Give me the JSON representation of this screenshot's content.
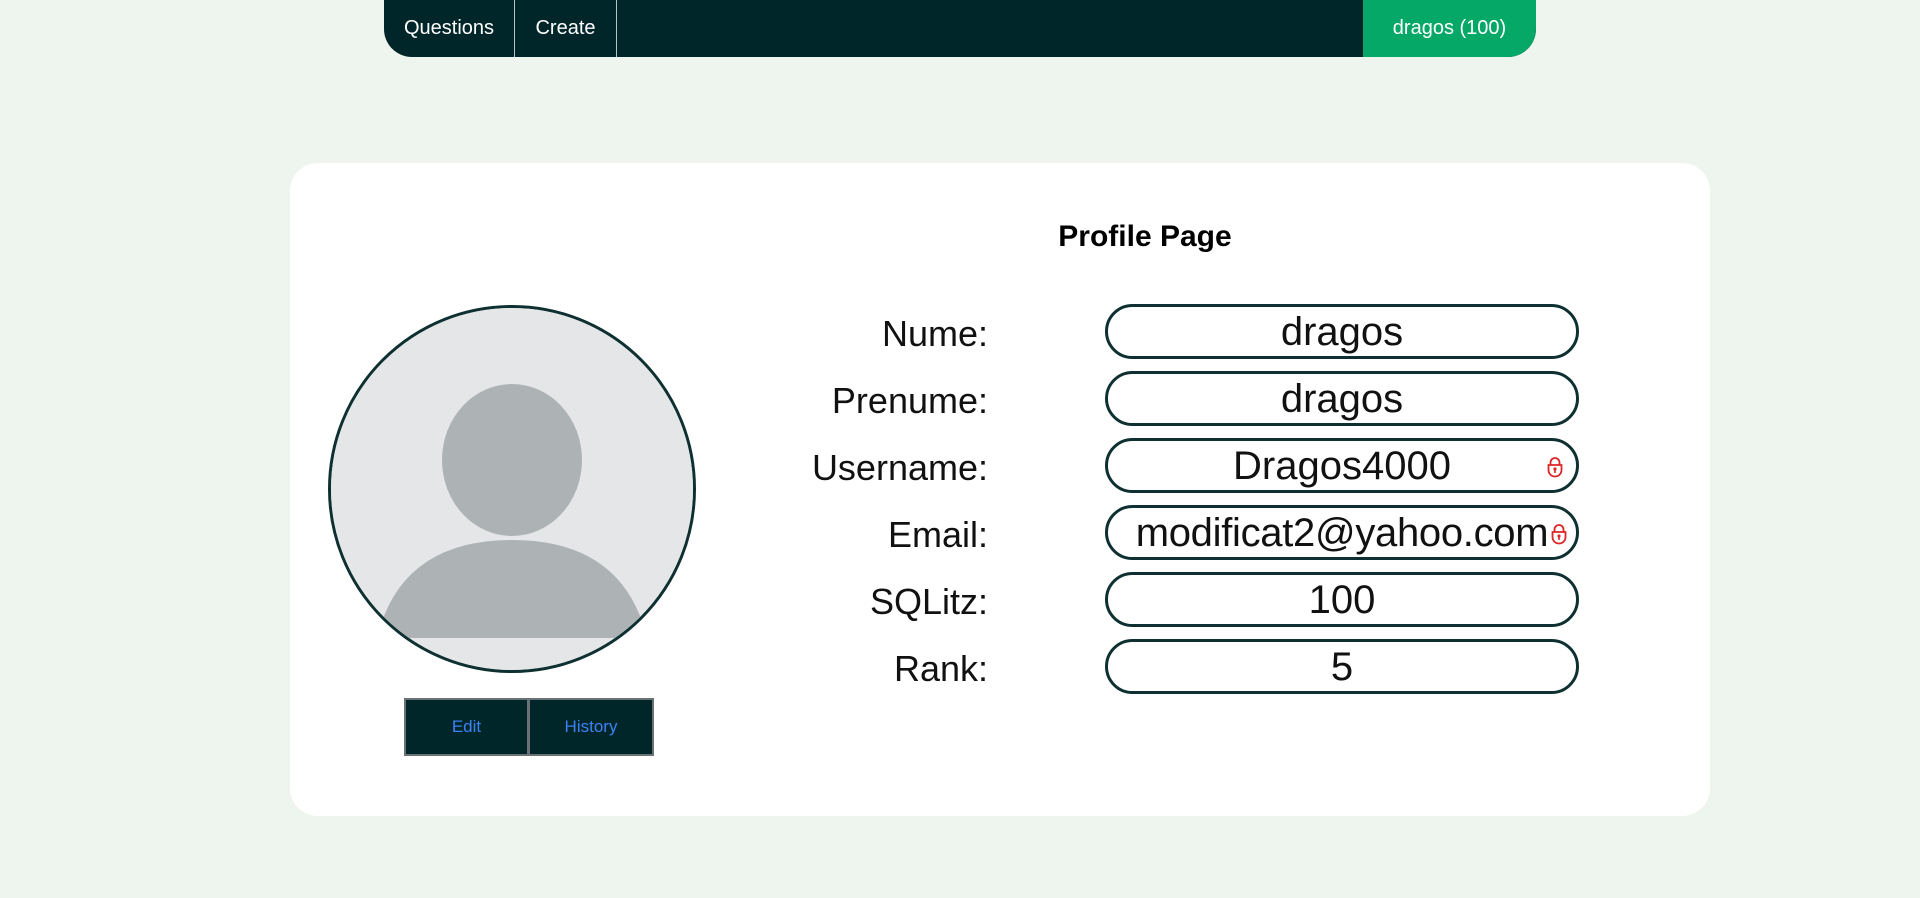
{
  "nav": {
    "questions": "Questions",
    "create": "Create",
    "user": "dragos (100)"
  },
  "profile": {
    "title": "Profile Page",
    "buttons": {
      "edit": "Edit",
      "history": "History"
    },
    "fields": [
      {
        "label": "Nume:",
        "value": "dragos",
        "locked": false
      },
      {
        "label": "Prenume:",
        "value": "dragos",
        "locked": false
      },
      {
        "label": "Username:",
        "value": "Dragos4000",
        "locked": true
      },
      {
        "label": "Email:",
        "value": "modificat2@yahoo.com",
        "locked": true
      },
      {
        "label": "SQLitz:",
        "value": "100",
        "locked": false
      },
      {
        "label": "Rank:",
        "value": "5",
        "locked": false
      }
    ]
  },
  "icons": {
    "avatar": "user-avatar-icon",
    "lock": "lock-icon"
  },
  "colors": {
    "nav_bg": "#002629",
    "accent_green": "#05a866",
    "page_bg": "#eef5ee",
    "border": "#0f3031",
    "lock": "#dc2626",
    "button_text": "#3b82f6"
  }
}
